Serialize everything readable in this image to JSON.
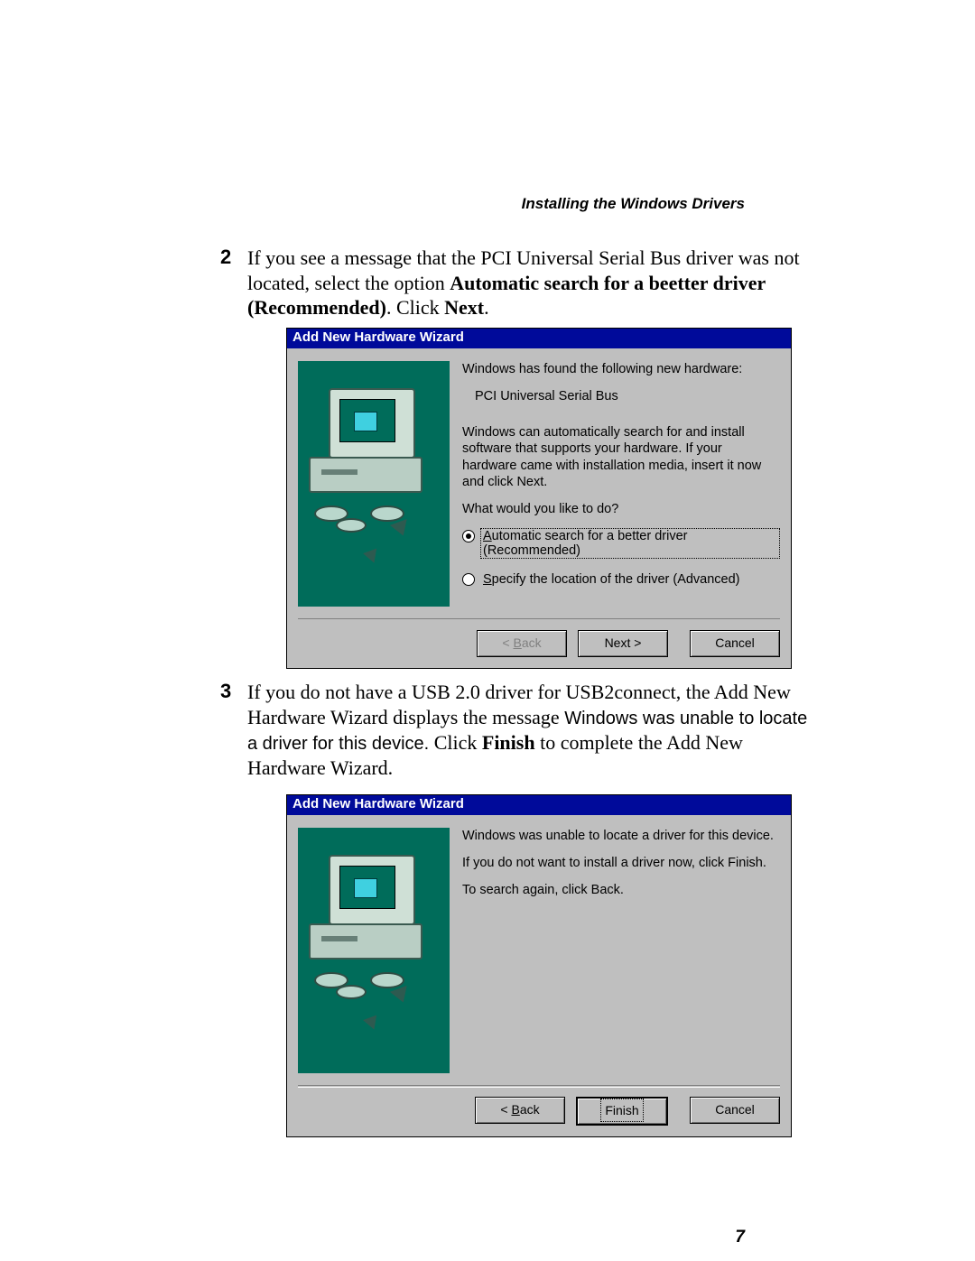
{
  "page": {
    "running_header": "Installing the Windows Drivers",
    "number": "7"
  },
  "steps": {
    "s2": {
      "num": "2",
      "t1": "If you see a message that the PCI Universal Serial Bus driver was not located, select the option ",
      "b1": "Automatic search for a beetter driver (Recommended)",
      "t2": ". Click ",
      "b2": "Next",
      "t3": "."
    },
    "s3": {
      "num": "3",
      "t1": "If you do not have a USB 2.0 driver for USB2connect, the Add New Hardware Wizard displays the message ",
      "m1": "Windows was unable to locate a driver for this device.",
      "t2": " Click ",
      "b1": "Finish",
      "t3": " to complete the Add New Hardware Wizard."
    }
  },
  "wizard1": {
    "title": "Add New Hardware Wizard",
    "line_found": "Windows has found the following new hardware:",
    "device": "PCI Universal Serial Bus",
    "line_auto": "Windows can automatically search for and install software that supports your hardware. If your hardware came with installation media, insert it now and click Next.",
    "prompt": "What would you like to do?",
    "radio1": {
      "u": "A",
      "rest": "utomatic search for a better driver (Recommended)"
    },
    "radio2": {
      "u": "S",
      "rest": "pecify the location of the driver (Advanced)"
    },
    "btn_back_pre": "< ",
    "btn_back_u": "B",
    "btn_back_rest": "ack",
    "btn_next": "Next >",
    "btn_cancel": "Cancel"
  },
  "wizard2": {
    "title": "Add New Hardware Wizard",
    "line1": "Windows was unable to locate a driver for this device.",
    "line2": "If you do not want to install a driver now, click Finish.",
    "line3": "To search again, click Back.",
    "btn_back_pre": "< ",
    "btn_back_u": "B",
    "btn_back_rest": "ack",
    "btn_finish": "Finish",
    "btn_cancel": "Cancel"
  }
}
